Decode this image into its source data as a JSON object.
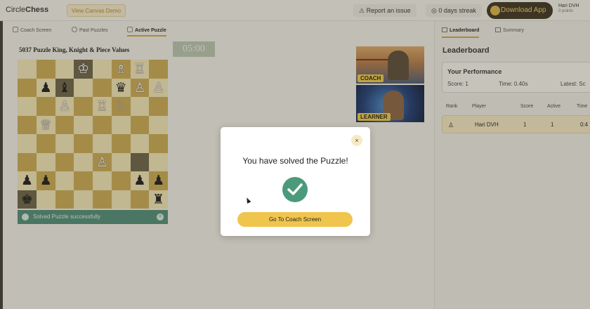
{
  "app": {
    "logo_light": "Circle",
    "logo_bold": "Chess",
    "demo_button": "View Canvas Demo",
    "report_button": "Report an issue",
    "streak": "0 days streak",
    "download_button": "Download App",
    "user_name": "Hari DVH",
    "user_points": "0 points"
  },
  "tabs": [
    {
      "label": "Coach Screen",
      "icon": "monitor-icon"
    },
    {
      "label": "Past Puzzles",
      "icon": "history-icon"
    },
    {
      "label": "Active Puzzle",
      "icon": "puzzle-icon",
      "active": true
    }
  ],
  "puzzle": {
    "title": "5037 Puzzle King, Knight & Piece Values",
    "timer": "05:00",
    "board": [
      [
        "",
        "",
        "",
        "wK",
        "",
        "wB",
        "wR",
        ""
      ],
      [
        "",
        "bP",
        "bB",
        "",
        "",
        "bQ",
        "wP",
        "wP"
      ],
      [
        "",
        "",
        "wP",
        "",
        "wR",
        "wN",
        "",
        ""
      ],
      [
        "",
        "wQ",
        "",
        "",
        "",
        "",
        "",
        ""
      ],
      [
        "",
        "",
        "",
        "",
        "",
        "",
        "",
        ""
      ],
      [
        "",
        "",
        "",
        "",
        "wP",
        "",
        "",
        ""
      ],
      [
        "bP",
        "bP",
        "",
        "",
        "",
        "",
        "bP",
        "bP"
      ],
      [
        "bK",
        "",
        "",
        "",
        "",
        "",
        "",
        "bR"
      ]
    ],
    "highlight": [
      [
        1,
        2
      ],
      [
        5,
        6
      ],
      [
        0,
        3
      ],
      [
        7,
        0
      ]
    ],
    "solved_message": "Solved Puzzle successfully"
  },
  "video": {
    "coach_label": "COACH",
    "learner_label": "LEARNER"
  },
  "right_panel": {
    "tabs": [
      {
        "label": "Leaderboard",
        "active": true
      },
      {
        "label": "Summary"
      }
    ],
    "title": "Leaderboard",
    "performance": {
      "title": "Your Performance",
      "score": "Score: 1",
      "time": "Time: 0.40s",
      "latest": "Latest: Sc"
    },
    "columns": [
      "Rank",
      "Player",
      "Score",
      "Active",
      "Time"
    ],
    "rows": [
      {
        "player": "Hari DVH",
        "score": "1",
        "active": "1",
        "time": "0:4"
      }
    ]
  },
  "modal": {
    "title": "You have solved the Puzzle!",
    "button": "Go To Coach Screen",
    "close": "×"
  },
  "colors": {
    "accent": "#efc54e",
    "success": "#4c9a7c",
    "board_light": "#f2e6b9",
    "board_dark": "#c9ab55"
  }
}
